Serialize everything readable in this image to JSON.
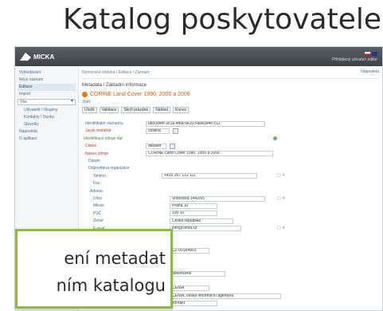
{
  "slide": {
    "title": "Katalog poskytovatele"
  },
  "app": {
    "logo_text": "MICKA",
    "user_text": "Přihlášený uživatel: editor"
  },
  "sidebar": {
    "items": [
      {
        "label": "Vyhledávání",
        "active": false
      },
      {
        "label": "Nový záznam",
        "active": false
      },
      {
        "label": "Editace",
        "active": true
      },
      {
        "label": "Import",
        "active": false
      }
    ],
    "select_value": "Vše",
    "sub_items": [
      {
        "label": "Uživatelé / Skupiny"
      },
      {
        "label": "Kontakty / Osoby"
      },
      {
        "label": "Slovníky"
      }
    ],
    "bottom_items": [
      {
        "label": "Nápověda"
      },
      {
        "label": "O aplikaci"
      }
    ]
  },
  "main": {
    "breadcrumb": "Domovská stránka / Editace / Záznam",
    "help_label": "Nápověda",
    "section_title": "Metadata / Základní informace",
    "record_title": "CORINE Land Cover 1990, 2000 a 2006",
    "back_label": "Zpět",
    "toolbar": [
      "Uložit",
      "Validace",
      "Skrýt prázdné",
      "Náhled",
      "Konec"
    ]
  },
  "form": {
    "rows": [
      {
        "label": "Identifikátor záznamu",
        "color": "blue",
        "value": "6b50d4fc-3c1a-4f8a-9e20-5a0b3e4f7c12"
      },
      {
        "label": "Jazyk metadat",
        "color": "red",
        "value": "čeština"
      },
      {
        "label": "Identifikace zdroje dat",
        "color": "green",
        "value": ""
      },
      {
        "label": "Citace",
        "color": "red",
        "value": "dataset"
      },
      {
        "label": "Název zdroje",
        "color": "red",
        "value": "CORINE Land Cover 1990, 2000 a 2006"
      },
      {
        "label": "Datum",
        "color": "blue",
        "value": ""
      },
      {
        "label": "Odpovědná organizace",
        "color": "blue",
        "value": ""
      },
      {
        "label": "Telefon",
        "color": "blue",
        "value": "+420 267 122 111"
      },
      {
        "label": "Fax",
        "color": "blue",
        "value": ""
      },
      {
        "label": "Adresa",
        "color": "blue",
        "value": ""
      },
      {
        "label": "Ulice",
        "color": "blue",
        "value": "Vršovická 1442/65"
      },
      {
        "label": "Město",
        "color": "blue",
        "value": "Praha 10"
      },
      {
        "label": "PSČ",
        "color": "blue",
        "value": "100 10"
      },
      {
        "label": "Země",
        "color": "blue",
        "value": "Česká republika"
      },
      {
        "label": "E-mail",
        "color": "blue",
        "value": "info@cenia.cz"
      },
      {
        "label": "Role",
        "color": "red",
        "value": "vlastník"
      },
      {
        "label": "Kódovaný výběr",
        "color": "blue",
        "value": ""
      },
      {
        "label": "Identifikátor zdroje",
        "color": "blue",
        "value": "CZ-00164801"
      },
      {
        "label": "Abstrakt",
        "color": "red",
        "value": ""
      },
      {
        "label": "Účel",
        "color": "blue",
        "value": ""
      },
      {
        "label": "Stav",
        "color": "blue",
        "value": "dokončeno"
      },
      {
        "label": "Kontaktní místo",
        "color": "green",
        "value": ""
      },
      {
        "label": "Jméno",
        "color": "red",
        "value": "CENIA"
      },
      {
        "label": "Organizace",
        "color": "blue",
        "value": "CENIA, česká informační agentura"
      },
      {
        "label": "Role",
        "color": "blue",
        "value": "kontakt"
      }
    ]
  },
  "callout": {
    "line1": "ení metadat",
    "line2": "ním katalogu"
  }
}
